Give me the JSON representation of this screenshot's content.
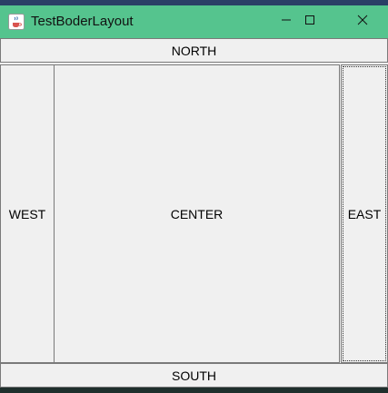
{
  "window": {
    "title": "TestBoderLayout",
    "controls": {
      "minimize_icon": "minimize-icon",
      "maximize_icon": "maximize-icon",
      "close_icon": "close-icon"
    },
    "app_icon": "java-coffee-cup-icon"
  },
  "layout": {
    "north": "NORTH",
    "west": "WEST",
    "center": "CENTER",
    "east": "EAST",
    "south": "SOUTH"
  },
  "colors": {
    "title_bar": "#55c48e",
    "background": "#f0f0f0",
    "border": "#7a7a7a"
  }
}
